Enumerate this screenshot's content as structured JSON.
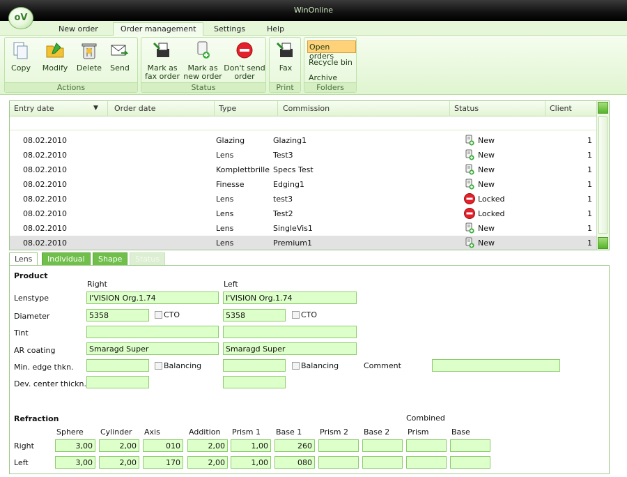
{
  "window": {
    "title": "WinOnline",
    "logo": "oV"
  },
  "menu": {
    "tabs": [
      "New order",
      "Order management",
      "Settings",
      "Help"
    ],
    "active": "Order management"
  },
  "ribbon": {
    "actions": {
      "label": "Actions",
      "buttons": [
        "Copy",
        "Modify",
        "Delete",
        "Send"
      ]
    },
    "status": {
      "label": "Status",
      "buttons": [
        "Mark as\nfax order",
        "Mark as\nnew order",
        "Don't send\norder"
      ]
    },
    "print": {
      "label": "Print",
      "buttons": [
        "Fax"
      ]
    },
    "folders": {
      "label": "Folders",
      "items": [
        "Open orders",
        "Recycle bin",
        "Archive"
      ],
      "active": "Open orders"
    }
  },
  "grid": {
    "columns": [
      "Entry date",
      "Order date",
      "Type",
      "Commission",
      "Status",
      "Client"
    ],
    "rows": [
      {
        "entry_date": "08.02.2010",
        "order_date": "",
        "type": "Glazing",
        "commission": "Glazing1",
        "status": "New",
        "status_icon": "new-order-icon",
        "client": "1"
      },
      {
        "entry_date": "08.02.2010",
        "order_date": "",
        "type": "Lens",
        "commission": "Test3",
        "status": "New",
        "status_icon": "new-order-icon",
        "client": "1"
      },
      {
        "entry_date": "08.02.2010",
        "order_date": "",
        "type": "Komplettbrille",
        "commission": "Specs Test",
        "status": "New",
        "status_icon": "new-order-icon",
        "client": "1"
      },
      {
        "entry_date": "08.02.2010",
        "order_date": "",
        "type": "Finesse",
        "commission": "Edging1",
        "status": "New",
        "status_icon": "new-order-icon",
        "client": "1"
      },
      {
        "entry_date": "08.02.2010",
        "order_date": "",
        "type": "Lens",
        "commission": "test3",
        "status": "Locked",
        "status_icon": "locked-icon",
        "client": "1"
      },
      {
        "entry_date": "08.02.2010",
        "order_date": "",
        "type": "Lens",
        "commission": "Test2",
        "status": "Locked",
        "status_icon": "locked-icon",
        "client": "1"
      },
      {
        "entry_date": "08.02.2010",
        "order_date": "",
        "type": "Lens",
        "commission": "SingleVis1",
        "status": "New",
        "status_icon": "new-order-icon",
        "client": "1"
      },
      {
        "entry_date": "08.02.2010",
        "order_date": "",
        "type": "Lens",
        "commission": "Premium1",
        "status": "New",
        "status_icon": "new-order-icon",
        "client": "1"
      }
    ],
    "selected_row": 7
  },
  "detail_tabs": {
    "tabs": [
      "Lens",
      "Individual",
      "Shape",
      "Status"
    ],
    "active": "Lens",
    "disabled": [
      "Status"
    ]
  },
  "product": {
    "heading": "Product",
    "right_label": "Right",
    "left_label": "Left",
    "lenstype_label": "Lenstype",
    "lenstype_right": "I'VISION Org.1.74",
    "lenstype_left": "I'VISION Org.1.74",
    "diameter_label": "Diameter",
    "diameter_right": "5358",
    "diameter_left": "5358",
    "cto_label": "CTO",
    "tint_label": "Tint",
    "tint_right": "",
    "tint_left": "",
    "ar_label": "AR coating",
    "ar_right": "Smaragd Super",
    "ar_left": "Smaragd Super",
    "min_edge_label": "Min. edge thkn.",
    "balancing_label": "Balancing",
    "comment_label": "Comment",
    "dev_center_label": "Dev. center thickn."
  },
  "refraction": {
    "heading": "Refraction",
    "combined_label": "Combined",
    "columns": [
      "Sphere",
      "Cylinder",
      "Axis",
      "Addition",
      "Prism 1",
      "Base 1",
      "Prism 2",
      "Base 2",
      "Prism",
      "Base"
    ],
    "rows": [
      {
        "label": "Right",
        "values": [
          "3,00",
          "2,00",
          "010",
          "2,00",
          "1,00",
          "260",
          "",
          "",
          "",
          ""
        ]
      },
      {
        "label": "Left",
        "values": [
          "3,00",
          "2,00",
          "170",
          "2,00",
          "1,00",
          "080",
          "",
          "",
          "",
          ""
        ]
      }
    ]
  },
  "colors": {
    "ribbon_bg": "#e6f7d9",
    "accent_green": "#6fbf4a",
    "field_bg": "#ddffc9",
    "active_folder": "#ffd27a"
  }
}
